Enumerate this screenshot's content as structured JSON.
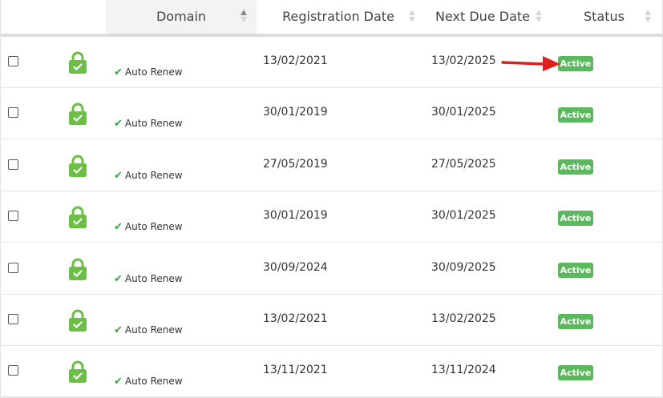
{
  "columns": {
    "domain": "Domain",
    "registration_date": "Registration Date",
    "next_due_date": "Next Due Date",
    "status": "Status"
  },
  "colors": {
    "active_badge": "#5cb85c",
    "lock_icon": "#6abf44",
    "annotation_arrow": "#e02020"
  },
  "rows": [
    {
      "auto_renew": "Auto Renew",
      "registration_date": "13/02/2021",
      "next_due_date": "13/02/2025",
      "status": "Active"
    },
    {
      "auto_renew": "Auto Renew",
      "registration_date": "30/01/2019",
      "next_due_date": "30/01/2025",
      "status": "Active"
    },
    {
      "auto_renew": "Auto Renew",
      "registration_date": "27/05/2019",
      "next_due_date": "27/05/2025",
      "status": "Active"
    },
    {
      "auto_renew": "Auto Renew",
      "registration_date": "30/01/2019",
      "next_due_date": "30/01/2025",
      "status": "Active"
    },
    {
      "auto_renew": "Auto Renew",
      "registration_date": "30/09/2024",
      "next_due_date": "30/09/2025",
      "status": "Active"
    },
    {
      "auto_renew": "Auto Renew",
      "registration_date": "13/02/2021",
      "next_due_date": "13/02/2025",
      "status": "Active"
    },
    {
      "auto_renew": "Auto Renew",
      "registration_date": "13/11/2021",
      "next_due_date": "13/11/2024",
      "status": "Active"
    }
  ]
}
